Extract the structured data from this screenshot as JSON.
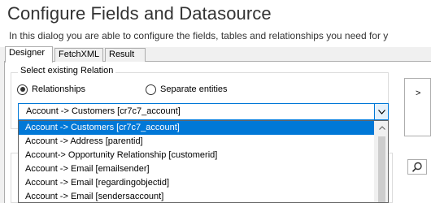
{
  "dialog": {
    "title": "Configure Fields and Datasource",
    "subtitle": "In this dialog you are able to configure the fields, tables and relationships you need for y"
  },
  "tabs": [
    {
      "label": "Designer",
      "active": true
    },
    {
      "label": "FetchXML",
      "active": false
    },
    {
      "label": "Result",
      "active": false
    }
  ],
  "relation_group": {
    "label": "Select existing Relation",
    "radio_relationships": {
      "label": "Relationships",
      "checked": true
    },
    "radio_separate": {
      "label": "Separate entities",
      "checked": false
    }
  },
  "relation_combo": {
    "value": "Account -> Customers    [cr7c7_account]",
    "options": [
      "Account -> Customers    [cr7c7_account]",
      "Account -> Address    [parentid]",
      "Account-> Opportunity Relationship    [customerid]",
      "Account -> Email    [emailsender]",
      "Account -> Email    [regardingobjectid]",
      "Account -> Email    [sendersaccount]"
    ],
    "selected_index": 0
  },
  "side_button": {
    "icon": "chevron-right-icon",
    "label": ">"
  },
  "search_button": {
    "icon": "search-icon"
  },
  "colors": {
    "accent": "#0078d7",
    "title_text": "#333333",
    "panel_background": "#f0f0f0"
  }
}
